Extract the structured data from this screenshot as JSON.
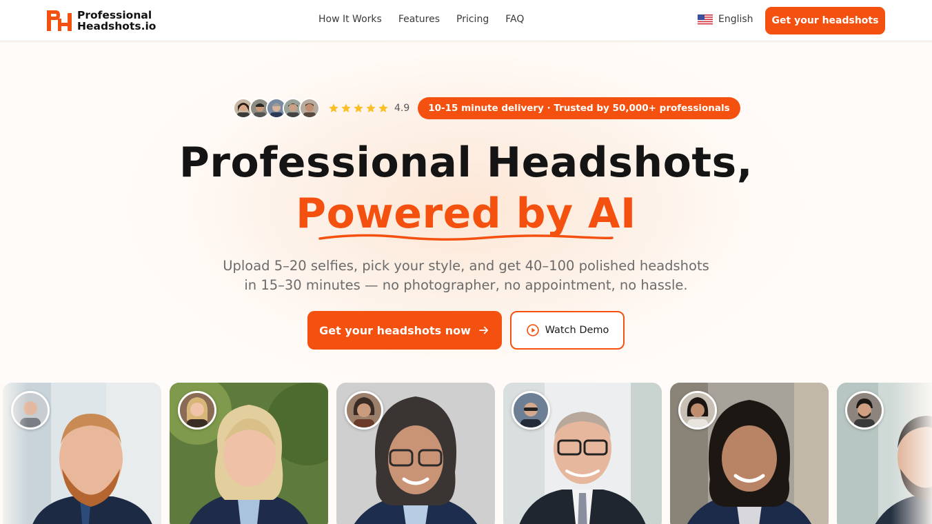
{
  "nav": {
    "logo_line1": "Professional",
    "logo_line2": "Headshots.io",
    "links": [
      "How It Works",
      "Features",
      "Pricing",
      "FAQ"
    ],
    "language": "English",
    "cta_label": "Get your headshots"
  },
  "hero": {
    "rating": "4.9",
    "badge": "10-15 minute delivery · Trusted by 50,000+ professionals",
    "headline_line1": "Professional Headshots,",
    "headline_line2": "Powered by AI",
    "subtitle_line1": "Upload 5–20 selfies, pick your style, and get 40–100 polished headshots",
    "subtitle_line2": "in 15–30 minutes — no photographer, no appointment, no hassle.",
    "cta_primary": "Get your headshots now",
    "cta_secondary": "Watch Demo"
  },
  "colors": {
    "brand": "#f4500f",
    "text": "#141414",
    "muted": "#6b6b6b",
    "star": "#fbbf24"
  },
  "icons": {
    "rating": "star-icon",
    "cta_primary": "arrow-right-icon",
    "cta_secondary": "play-circle-icon",
    "language": "us-flag-icon"
  }
}
